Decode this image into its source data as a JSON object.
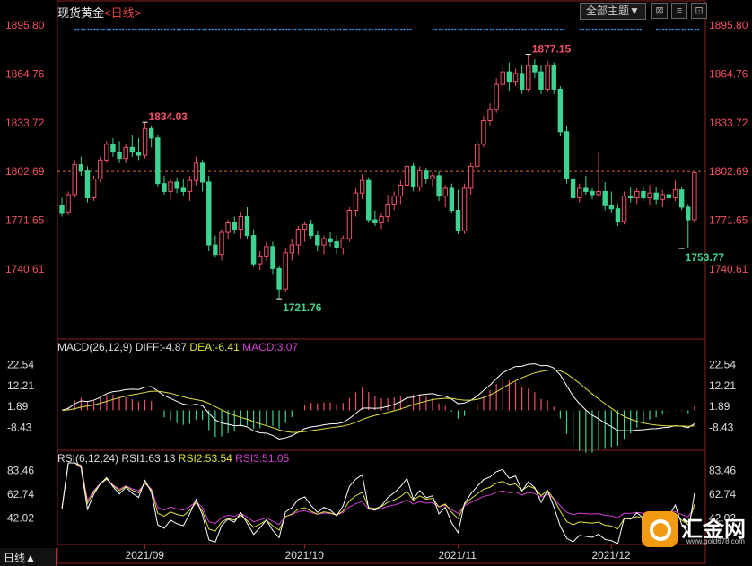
{
  "header": {
    "title": "现货黄金",
    "period_tag": "<日线>",
    "theme_button": "全部主题▼",
    "window_buttons": [
      "⊠",
      "≡",
      "⊡"
    ]
  },
  "bottom_bar": {
    "label": "日线▲"
  },
  "logo": {
    "name": "汇金网",
    "site": "www.gold678.com"
  },
  "colors": {
    "up": "#f0506a",
    "down": "#3cd490",
    "diff": "#ffffff",
    "dea": "#e0e040",
    "rsi1": "#ffffff",
    "rsi2": "#e0e040",
    "rsi3": "#d040d0",
    "axis_text": "#f05060",
    "ref_line": "#d86a3a",
    "dots": "#3a8ee8"
  },
  "chart_data": [
    {
      "type": "candlestick",
      "yticks": [
        "1895.80",
        "1864.76",
        "1833.72",
        "1802.69",
        "1771.65",
        "1740.61"
      ],
      "ylim": [
        1715,
        1898
      ],
      "xticks": [
        "2021/09",
        "2021/10",
        "2021/11",
        "2021/12"
      ],
      "xtick_index": [
        13,
        38,
        62,
        86
      ],
      "reference_line": 1802.69,
      "annotations": [
        {
          "text": "1834.03",
          "index": 13,
          "value": 1834.03,
          "kind": "high"
        },
        {
          "text": "1877.15",
          "index": 73,
          "value": 1877.15,
          "kind": "high"
        },
        {
          "text": "1721.76",
          "index": 34,
          "value": 1721.76,
          "kind": "low"
        },
        {
          "text": "1753.77",
          "index": 97,
          "value": 1753.77,
          "kind": "low"
        }
      ],
      "ohlc": [
        [
          1781,
          1786,
          1774,
          1776
        ],
        [
          1777,
          1790,
          1775,
          1788
        ],
        [
          1788,
          1810,
          1786,
          1807
        ],
        [
          1807,
          1812,
          1800,
          1803
        ],
        [
          1803,
          1806,
          1783,
          1786
        ],
        [
          1786,
          1800,
          1784,
          1798
        ],
        [
          1798,
          1812,
          1796,
          1810
        ],
        [
          1810,
          1822,
          1808,
          1820
        ],
        [
          1820,
          1824,
          1812,
          1815
        ],
        [
          1815,
          1822,
          1808,
          1811
        ],
        [
          1811,
          1820,
          1808,
          1818
        ],
        [
          1818,
          1826,
          1812,
          1815
        ],
        [
          1815,
          1824,
          1810,
          1813
        ],
        [
          1813,
          1834.03,
          1811,
          1830
        ],
        [
          1830,
          1832,
          1818,
          1824
        ],
        [
          1824,
          1826,
          1793,
          1795
        ],
        [
          1795,
          1800,
          1788,
          1790
        ],
        [
          1790,
          1798,
          1785,
          1796
        ],
        [
          1796,
          1799,
          1789,
          1792
        ],
        [
          1792,
          1798,
          1787,
          1790
        ],
        [
          1790,
          1800,
          1784,
          1797
        ],
        [
          1797,
          1812,
          1794,
          1808
        ],
        [
          1808,
          1810,
          1790,
          1796
        ],
        [
          1796,
          1800,
          1752,
          1756
        ],
        [
          1756,
          1762,
          1748,
          1750
        ],
        [
          1750,
          1766,
          1746,
          1764
        ],
        [
          1764,
          1772,
          1760,
          1770
        ],
        [
          1770,
          1774,
          1763,
          1766
        ],
        [
          1766,
          1777,
          1760,
          1774
        ],
        [
          1774,
          1780,
          1760,
          1762
        ],
        [
          1762,
          1766,
          1742,
          1744
        ],
        [
          1744,
          1752,
          1740,
          1749
        ],
        [
          1749,
          1758,
          1746,
          1755
        ],
        [
          1755,
          1758,
          1737,
          1741
        ],
        [
          1741,
          1743,
          1721.76,
          1728
        ],
        [
          1728,
          1754,
          1726,
          1751
        ],
        [
          1751,
          1760,
          1746,
          1756
        ],
        [
          1756,
          1768,
          1750,
          1766
        ],
        [
          1766,
          1771,
          1758,
          1769
        ],
        [
          1769,
          1772,
          1760,
          1762
        ],
        [
          1762,
          1765,
          1752,
          1756
        ],
        [
          1756,
          1762,
          1750,
          1760
        ],
        [
          1760,
          1764,
          1755,
          1758
        ],
        [
          1758,
          1762,
          1750,
          1754
        ],
        [
          1754,
          1762,
          1750,
          1760
        ],
        [
          1760,
          1780,
          1758,
          1778
        ],
        [
          1778,
          1792,
          1774,
          1789
        ],
        [
          1789,
          1801,
          1785,
          1797
        ],
        [
          1797,
          1799,
          1770,
          1772
        ],
        [
          1772,
          1778,
          1768,
          1770
        ],
        [
          1770,
          1776,
          1766,
          1774
        ],
        [
          1774,
          1788,
          1771,
          1782
        ],
        [
          1782,
          1790,
          1778,
          1787
        ],
        [
          1787,
          1797,
          1782,
          1794
        ],
        [
          1794,
          1812,
          1790,
          1806
        ],
        [
          1806,
          1808,
          1790,
          1793
        ],
        [
          1793,
          1806,
          1790,
          1803
        ],
        [
          1803,
          1805,
          1795,
          1798
        ],
        [
          1798,
          1802,
          1793,
          1800
        ],
        [
          1800,
          1803,
          1784,
          1787
        ],
        [
          1787,
          1794,
          1780,
          1792
        ],
        [
          1792,
          1795,
          1776,
          1778
        ],
        [
          1778,
          1791,
          1763,
          1765
        ],
        [
          1765,
          1795,
          1763,
          1792
        ],
        [
          1792,
          1808,
          1788,
          1806
        ],
        [
          1806,
          1822,
          1804,
          1820
        ],
        [
          1820,
          1838,
          1818,
          1835
        ],
        [
          1835,
          1846,
          1832,
          1842
        ],
        [
          1842,
          1862,
          1840,
          1858
        ],
        [
          1858,
          1870,
          1853,
          1866
        ],
        [
          1866,
          1872,
          1854,
          1860
        ],
        [
          1860,
          1868,
          1857,
          1865
        ],
        [
          1865,
          1870,
          1852,
          1855
        ],
        [
          1855,
          1877.15,
          1853,
          1870
        ],
        [
          1870,
          1874,
          1862,
          1866
        ],
        [
          1866,
          1870,
          1852,
          1855
        ],
        [
          1855,
          1873,
          1853,
          1870
        ],
        [
          1870,
          1872,
          1852,
          1855
        ],
        [
          1855,
          1857,
          1825,
          1828
        ],
        [
          1828,
          1832,
          1795,
          1798
        ],
        [
          1798,
          1800,
          1783,
          1786
        ],
        [
          1786,
          1795,
          1783,
          1792
        ],
        [
          1792,
          1800,
          1788,
          1790
        ],
        [
          1790,
          1792,
          1785,
          1788
        ],
        [
          1788,
          1815,
          1786,
          1790
        ],
        [
          1790,
          1796,
          1778,
          1781
        ],
        [
          1781,
          1790,
          1776,
          1779
        ],
        [
          1779,
          1782,
          1768,
          1771
        ],
        [
          1771,
          1790,
          1769,
          1787
        ],
        [
          1787,
          1793,
          1783,
          1786
        ],
        [
          1786,
          1792,
          1782,
          1790
        ],
        [
          1790,
          1793,
          1784,
          1786
        ],
        [
          1786,
          1794,
          1781,
          1789
        ],
        [
          1789,
          1793,
          1782,
          1785
        ],
        [
          1785,
          1791,
          1780,
          1788
        ],
        [
          1788,
          1792,
          1782,
          1786
        ],
        [
          1786,
          1797,
          1784,
          1791
        ],
        [
          1791,
          1793,
          1778,
          1780
        ],
        [
          1780,
          1782,
          1753.77,
          1772
        ],
        [
          1772,
          1803,
          1770,
          1802
        ]
      ]
    },
    {
      "type": "macd",
      "title": "MACD(26,12,9)",
      "labels": {
        "diff": "DIFF:-4.87",
        "dea": "DEA:-6.41",
        "macd": "MACD:3.07"
      },
      "yticks": [
        "22.54",
        "12.21",
        "1.89",
        "-8.43"
      ],
      "ylim": [
        -18,
        29
      ]
    },
    {
      "type": "rsi",
      "title": "RSI(6,12,24)",
      "labels": {
        "rsi1": "RSI1:63.13",
        "rsi2": "RSI2:53.54",
        "rsi3": "RSI3:51.05"
      },
      "yticks": [
        "83.46",
        "62.74",
        "42.02"
      ],
      "ylim": [
        20,
        90
      ]
    }
  ]
}
